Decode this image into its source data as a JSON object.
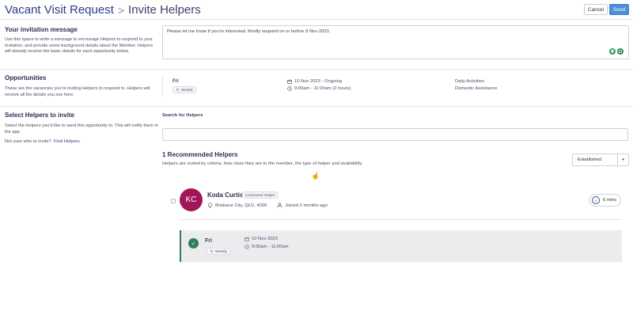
{
  "header": {
    "title": "Vacant Visit Request",
    "separator": ">",
    "subtitle": "Invite Helpers",
    "cancel_label": "Cancel",
    "send_label": "Send"
  },
  "invitation": {
    "title": "Your invitation message",
    "description": "Use this space to write a message to encourage Helpers to respond to your invitation, and provide some background details about the Member. Helpers will already receive the basic details for each opportunity below.",
    "message": "Please let me know if you're interested. Kindly respond on or before 9 Nov 2023."
  },
  "opportunities": {
    "title": "Opportunities",
    "description": "These are the vacancies you're inviting Helpers to respond to. Helpers will receive all the details you see here.",
    "items": [
      {
        "day": "Fri",
        "frequency": "Weekly",
        "date_range": "10 Nov 2023 - Ongoing",
        "time": "9:00am - 11:00am (2 hours)",
        "services": [
          "Daily Activities",
          "Domestic Assistance"
        ]
      }
    ]
  },
  "select_helpers": {
    "title": "Select Helpers to invite",
    "description": "Select the Helpers you'd like to send this opportunity to. This will notify them in the app.",
    "not_sure_prefix": "Not sure who to invite?",
    "find_helpers_link": "Find Helpers"
  },
  "search": {
    "label": "Search for Helpers",
    "placeholder": ""
  },
  "recommended": {
    "title": "1 Recommended Helpers",
    "description": "Helpers are sorted by criteria, how close they are to the member, the type of helper and availability.",
    "sort_selected": "Established"
  },
  "helpers": [
    {
      "initials": "KC",
      "name": "Koda Curtis",
      "badge": "Contracted Helper",
      "location": "Brisbane City, QLD, 4000",
      "joined": "Joined 2 months ago",
      "travel_time": "6 mins",
      "travel_time_short": "6",
      "avatar_color": "#a3155a",
      "match": {
        "day": "Fri",
        "frequency": "Weekly",
        "date": "10 Nov 2023",
        "time": "9:00am - 11:00am"
      }
    }
  ],
  "colors": {
    "accent": "#2d3a8c",
    "send_button": "#4a90d9",
    "match_green": "#2e7d5b"
  }
}
